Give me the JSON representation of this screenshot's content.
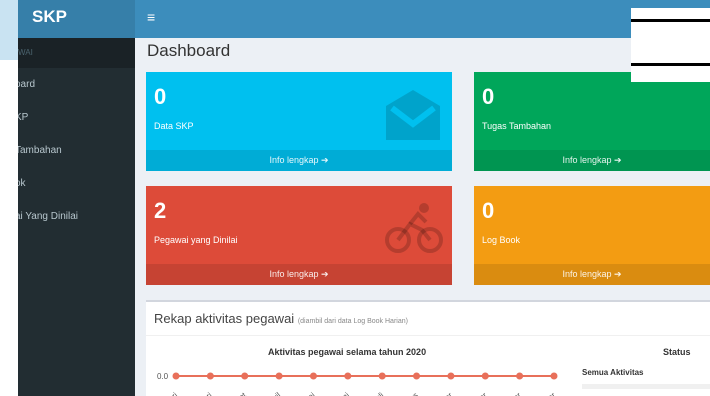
{
  "app": {
    "logo": "SKP",
    "menu_icon": "≡"
  },
  "sidebar": {
    "header": "WAI",
    "items": [
      {
        "label": "oard"
      },
      {
        "label": "KP"
      },
      {
        "label": "Tambahan"
      },
      {
        "label": "ok"
      },
      {
        "label": "ai Yang Dinilai"
      }
    ]
  },
  "page": {
    "title": "Dashboard"
  },
  "boxes": [
    {
      "value": "0",
      "label": "Data SKP",
      "link": "Info lengkap ➔",
      "color": "#00c0ef",
      "icon": "envelope-icon"
    },
    {
      "value": "0",
      "label": "Tugas Tambahan",
      "link": "Info lengkap ➔",
      "color": "#00a65a",
      "icon": "none"
    },
    {
      "value": "2",
      "label": "Pegawai yang Dinilai",
      "link": "Info lengkap ➔",
      "color": "#dd4b39",
      "icon": "bicycle-icon"
    },
    {
      "value": "0",
      "label": "Log Book",
      "link": "Info lengkap ➔",
      "color": "#f39c12",
      "icon": "none"
    }
  ],
  "panel": {
    "title": "Rekap aktivitas pegawai",
    "subtitle": "(diambil dari data Log Book Harian)",
    "status_title": "Status",
    "status_item": "Semua Aktivitas"
  },
  "chart_data": {
    "type": "line",
    "title": "Aktivitas pegawai selama tahun 2020",
    "categories": [
      "Januari",
      "Februari",
      "Maret",
      "April",
      "Mei",
      "Juni",
      "Juli",
      "Agustus",
      "September",
      "Oktober",
      "November",
      "Desember"
    ],
    "tick_labels_visible": [
      "ari",
      "uari",
      "aret",
      "pril",
      "Mei",
      "Juni",
      "Juli",
      "stus",
      "mber",
      "ober",
      "mber",
      "mber"
    ],
    "values": [
      0,
      0,
      0,
      0,
      0,
      0,
      0,
      0,
      0,
      0,
      0,
      0
    ],
    "y_tick": "0.0",
    "color": "#e8705a"
  }
}
